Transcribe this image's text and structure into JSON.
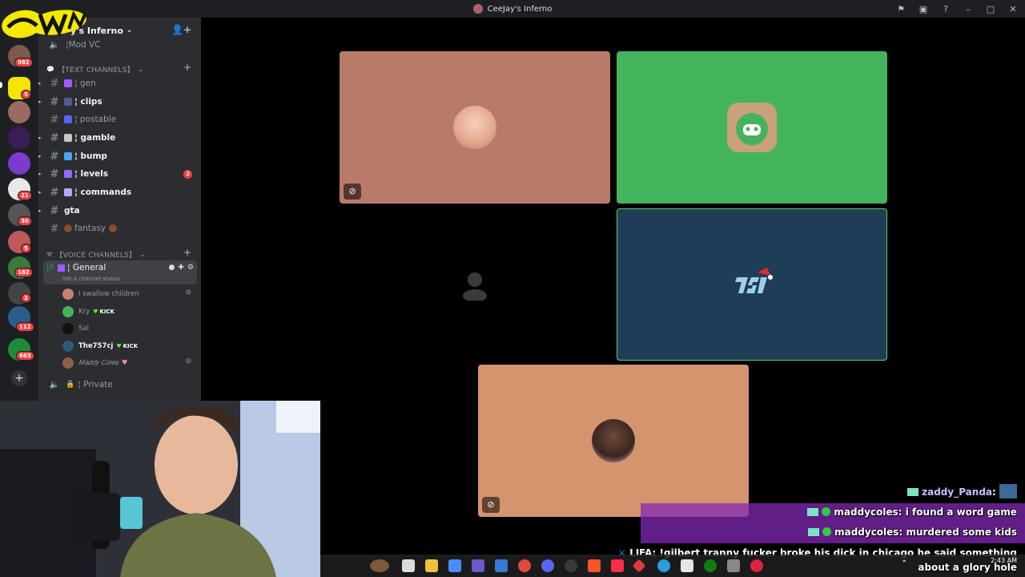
{
  "window": {
    "title": "CeeJay's Inferno"
  },
  "titlebar_icons": [
    "inbox-icon",
    "screen-icon",
    "help-icon",
    "minimize-icon",
    "maximize-icon",
    "close-icon"
  ],
  "server": {
    "name": "y's Inferno",
    "top_channel": "Mod VC"
  },
  "rail": {
    "badges": [
      "982",
      "5",
      "21",
      "30",
      "5",
      "182",
      "2",
      "112",
      "683"
    ]
  },
  "categories": {
    "text": "【TEXT CHANNELS】",
    "voice": "【VOICE CHANNELS】"
  },
  "text_channels": [
    {
      "name": "¦ gen",
      "bold": false
    },
    {
      "name": "¦ clips",
      "bold": true
    },
    {
      "name": "¦ postable",
      "bold": false
    },
    {
      "name": "¦ gamble",
      "bold": true
    },
    {
      "name": "¦ bump",
      "bold": true
    },
    {
      "name": "¦ levels",
      "bold": true,
      "mentions": "2"
    },
    {
      "name": "¦ commands",
      "bold": true
    },
    {
      "name": "gta",
      "bold": true
    },
    {
      "name": "fantasy",
      "bold": false
    }
  ],
  "voice": {
    "general": "¦ General",
    "status": "Set a channel status",
    "users": [
      {
        "name": "I swallow children"
      },
      {
        "name": "Kry",
        "tag": "KICK"
      },
      {
        "name": "Sal"
      },
      {
        "name": "The757cj",
        "tag": "KICK"
      },
      {
        "name": "𝑀𝑎𝑑𝑑𝑦 𝐶𝑜𝑙𝑒𝑠"
      }
    ],
    "private": "¦ Private"
  },
  "kick_label": "KICK",
  "tiles": [
    {
      "color": "#b97b69"
    },
    {
      "color": "#43b45c"
    },
    {
      "color": "#000000"
    },
    {
      "color": "#1f3d57"
    },
    {
      "color": "#d4946d"
    }
  ],
  "chat": [
    {
      "user": "zaddy_Panda",
      "text": ""
    },
    {
      "user": "maddycoles",
      "text": "i found a word game"
    },
    {
      "user": "maddycoles",
      "text": "murdered some kids"
    },
    {
      "user": "LIFA",
      "text": "!gilbert tranny fucker broke his dick in chicago he said something"
    },
    {
      "user": "",
      "text": "about a glory hole"
    }
  ],
  "taskbar": {
    "time": "2:43 AM"
  }
}
